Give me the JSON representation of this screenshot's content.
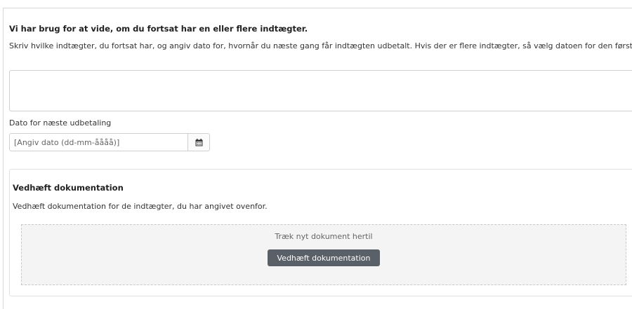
{
  "income": {
    "question": "Vi har brug for at vide, om du fortsat har en eller flere indtægter.",
    "description": "Skriv hvilke indtægter, du fortsat har, og angiv dato for, hvornår du næste gang får indtægten udbetalt. Hvis der er flere indtægter, så vælg datoen for den første.",
    "textarea_value": ""
  },
  "payment_date": {
    "label": "Dato for næste udbetaling",
    "placeholder": "[Angiv dato (dd-mm-åååå)]",
    "value": "",
    "icon": "calendar-icon"
  },
  "documentation": {
    "title": "Vedhæft dokumentation",
    "description": "Vedhæft dokumentation for de indtægter, du har angivet ovenfor.",
    "drop_text": "Træk nyt dokument hertil",
    "button_label": "Vedhæft dokumentation"
  },
  "colors": {
    "button_bg": "#5a6068",
    "dropzone_bg": "#f4f4f4",
    "border": "#cfcfcf"
  }
}
